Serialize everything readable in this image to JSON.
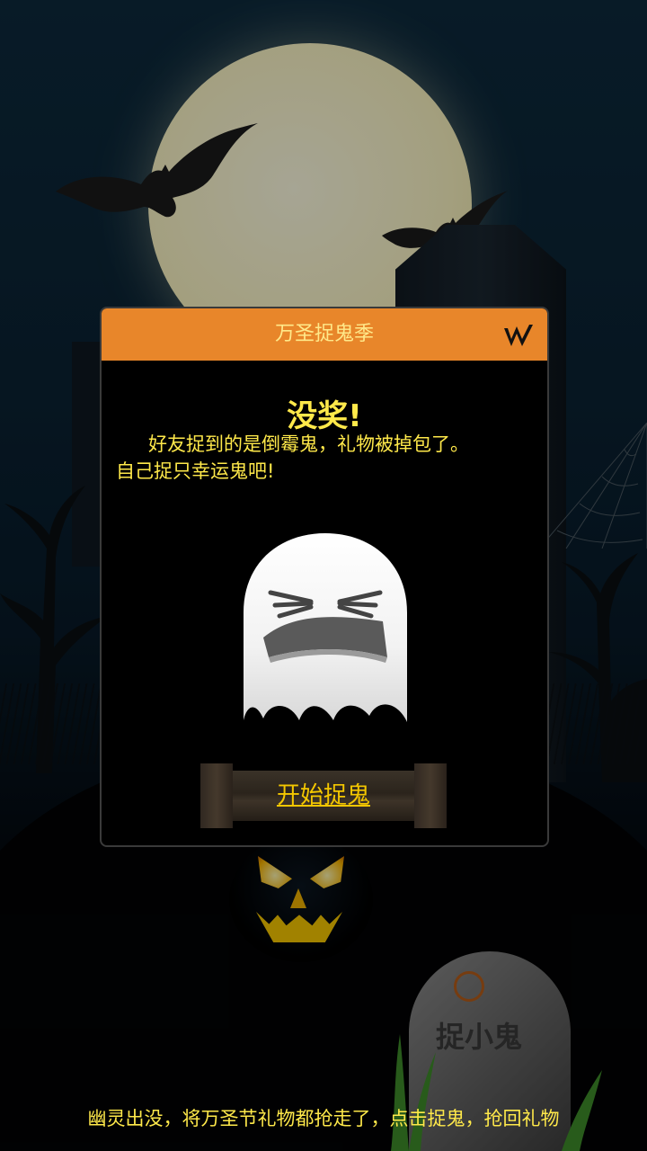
{
  "dialog": {
    "title": "万圣捉鬼季",
    "headline": "没奖!",
    "message_line1": "好友捉到的是倒霉鬼，礼物被掉包了。",
    "message_line2": "自己捉只幸运鬼吧!",
    "start_button_label": "开始捉鬼",
    "close_icon": "close-icon"
  },
  "background": {
    "tombstone_text": "捉小鬼"
  },
  "footer": {
    "text": "幽灵出没，将万圣节礼物都抢走了，点击捉鬼，抢回礼物"
  },
  "colors": {
    "accent_orange": "#e8862a",
    "text_yellow": "#ffe94a",
    "button_text": "#f4c700"
  }
}
